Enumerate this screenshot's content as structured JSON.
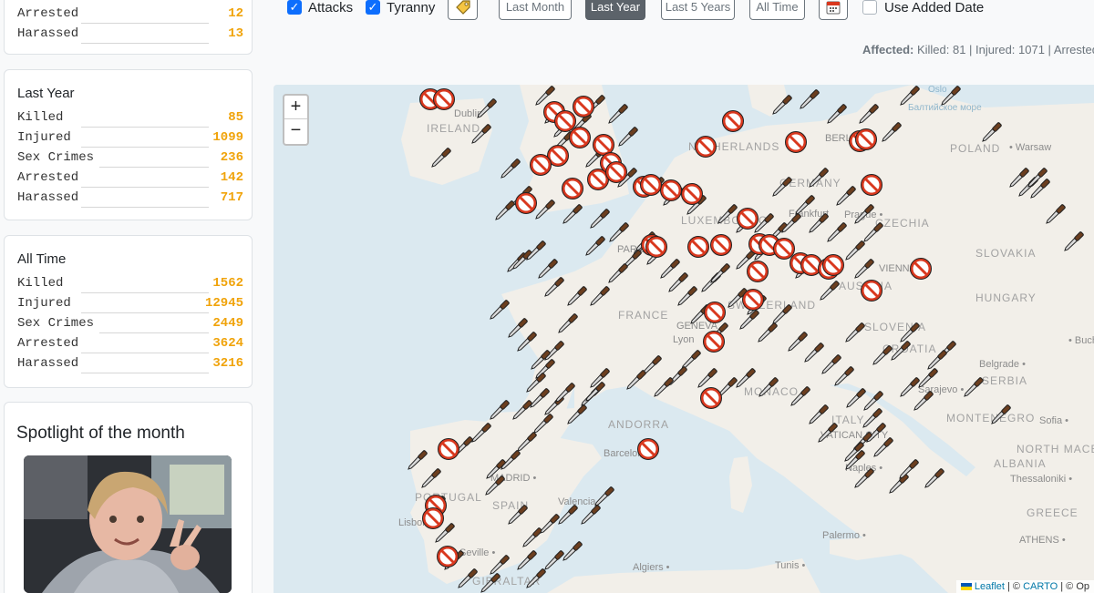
{
  "cards": [
    {
      "title": "",
      "stats": [
        {
          "label": "Arrested",
          "value": "12"
        },
        {
          "label": "Harassed",
          "value": "13"
        }
      ]
    },
    {
      "title": "Last Year",
      "stats": [
        {
          "label": "Killed",
          "value": "85"
        },
        {
          "label": "Injured",
          "value": "1099"
        },
        {
          "label": "Sex Crimes",
          "value": "236"
        },
        {
          "label": "Arrested",
          "value": "142"
        },
        {
          "label": "Harassed",
          "value": "717"
        }
      ]
    },
    {
      "title": "All Time",
      "stats": [
        {
          "label": "Killed",
          "value": "1562"
        },
        {
          "label": "Injured",
          "value": "12945"
        },
        {
          "label": "Sex Crimes",
          "value": "2449"
        },
        {
          "label": "Arrested",
          "value": "3624"
        },
        {
          "label": "Harassed",
          "value": "3216"
        }
      ]
    }
  ],
  "spotlight": {
    "title": "Spotlight of the month"
  },
  "filters": {
    "attacks_label": "Attacks",
    "attacks_checked": true,
    "tyranny_label": "Tyranny",
    "tyranny_checked": true,
    "tag_icon": "tag-icon",
    "ranges": [
      "Last Month",
      "Last Year",
      "Last 5 Years",
      "All Time"
    ],
    "active_range": "Last Year",
    "calendar_icon": "calendar-icon",
    "use_added_date_label": "Use Added Date",
    "use_added_date_checked": false
  },
  "affected": {
    "label": "Affected:",
    "text": "Killed: 81 | Injured: 1071 | Arrested"
  },
  "map": {
    "zoom_in": "+",
    "zoom_out": "−",
    "attribution": {
      "leaflet": "Leaflet",
      "sep1": " | © ",
      "carto": "CARTO",
      "sep2": " | © Op"
    },
    "labels": {
      "dublin": "Dublin",
      "ireland": "IRELAND",
      "berlin": "BERLIN",
      "poland": "POLAND",
      "warsaw": "• Warsaw",
      "netherlands": "NETHERLANDS",
      "germany": "GERMANY",
      "luxembourg": "LUXEMBOURG",
      "frankfurt": "Frankfurt",
      "prague": "Prague •",
      "czechia": "CZECHIA",
      "slovakia": "SLOVAKIA",
      "vienna": "VIENNA",
      "austria": "AUSTRIA",
      "hungary": "HUNGARY",
      "paris": "PARIS",
      "france": "FRANCE",
      "switzerland": "SWITZERLAND",
      "geneva": "GENEVA",
      "lyon": "Lyon",
      "slovenia": "SLOVENIA",
      "croatia": "CROATIA",
      "belgrade": "Belgrade •",
      "serbia": "SERBIA",
      "bucharest": "• Bucharest",
      "sarajevo": "Sarajevo •",
      "montenegro": "MONTENEGRO",
      "sofia": "Sofia •",
      "north_macedonia": "NORTH MACEDONIA",
      "albania": "ALBANIA",
      "thessaloniki": "Thessaloniki •",
      "greece": "GREECE",
      "athens": "ATHENS •",
      "andorra": "ANDORRA",
      "barcelona": "Barcelona",
      "monaco": "MONACO",
      "italy": "ITALY",
      "vatican": "VATICAN CITY",
      "naples": "Naples •",
      "portugal": "PORTUGAL",
      "madrid": "MADRID •",
      "spain": "SPAIN",
      "valencia": "Valencia •",
      "lisbon": "Lisbon",
      "seville": "Seville •",
      "gibraltar": "GIBRALTAR",
      "algiers": "Algiers •",
      "tunis": "Tunis •",
      "palermo": "Palermo •",
      "oslo": "Oslo",
      "baltic": "Балтийское море"
    }
  },
  "colors": {
    "accent": "#0d6efd",
    "stat_value": "#f0a30a",
    "prohibited": "#d9381e",
    "knife_handle": "#6b3e1f"
  }
}
